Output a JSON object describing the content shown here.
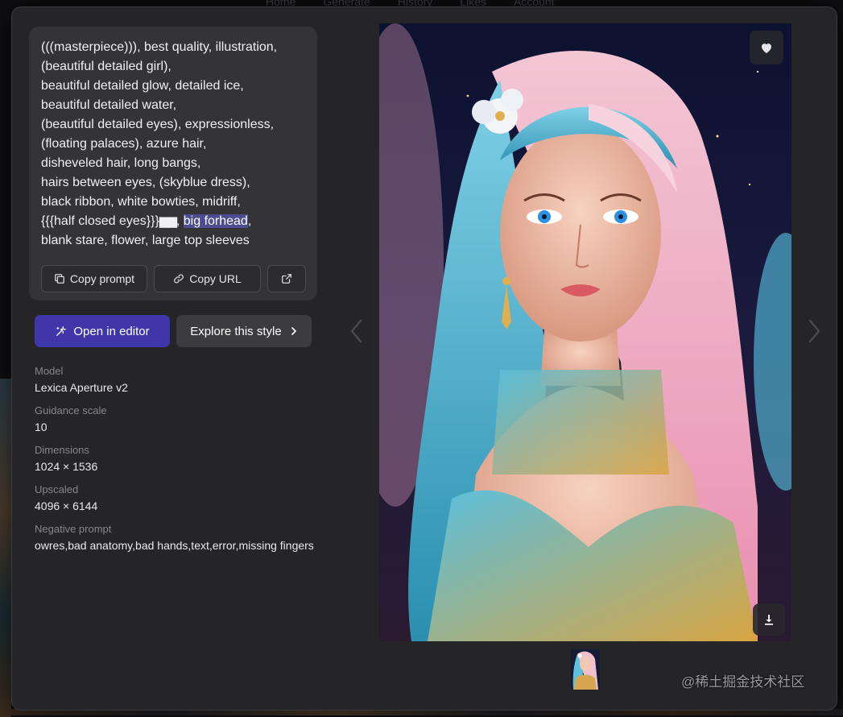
{
  "background_nav": [
    "Home",
    "Generate",
    "History",
    "Likes",
    "Account"
  ],
  "prompt": {
    "lines": [
      "(((masterpiece))), best quality, illustration,",
      "(beautiful detailed girl),",
      "beautiful detailed glow, detailed ice,",
      "beautiful detailed water,",
      "(beautiful detailed eyes), expressionless,",
      "(floating palaces), azure hair,",
      "disheveled hair, long bangs,",
      "hairs between eyes, (skyblue dress),",
      "black ribbon, white bowties, midriff,"
    ],
    "line10_start": "{{{half closed eyes}}}",
    "line10_glyph": "▆▆",
    "line10_comma": ", ",
    "line10_highlight": "big forhead",
    "line10_end": ",",
    "line11": "blank stare, flower, large top sleeves"
  },
  "actions": {
    "copy_prompt": "Copy prompt",
    "copy_url": "Copy URL",
    "open_in_editor": "Open in editor",
    "explore_style": "Explore this style"
  },
  "details": [
    {
      "label": "Model",
      "value": "Lexica Aperture v2"
    },
    {
      "label": "Guidance scale",
      "value": "10"
    },
    {
      "label": "Dimensions",
      "value": "1024 × 1536"
    },
    {
      "label": "Upscaled",
      "value": "4096 × 6144"
    },
    {
      "label": "Negative prompt",
      "value": "owres,bad anatomy,bad hands,text,error,missing fingers"
    }
  ],
  "watermark": "@稀土掘金技术社区",
  "colors": {
    "modal_bg": "#252528",
    "card_bg": "#343438",
    "primary": "#3f37a9",
    "highlight": "#4b4d8f"
  },
  "icons": [
    "copy-icon",
    "link-icon",
    "external-link-icon",
    "magic-wand-icon",
    "chevron-right-icon",
    "heart-icon",
    "download-icon",
    "chevron-left-icon"
  ]
}
